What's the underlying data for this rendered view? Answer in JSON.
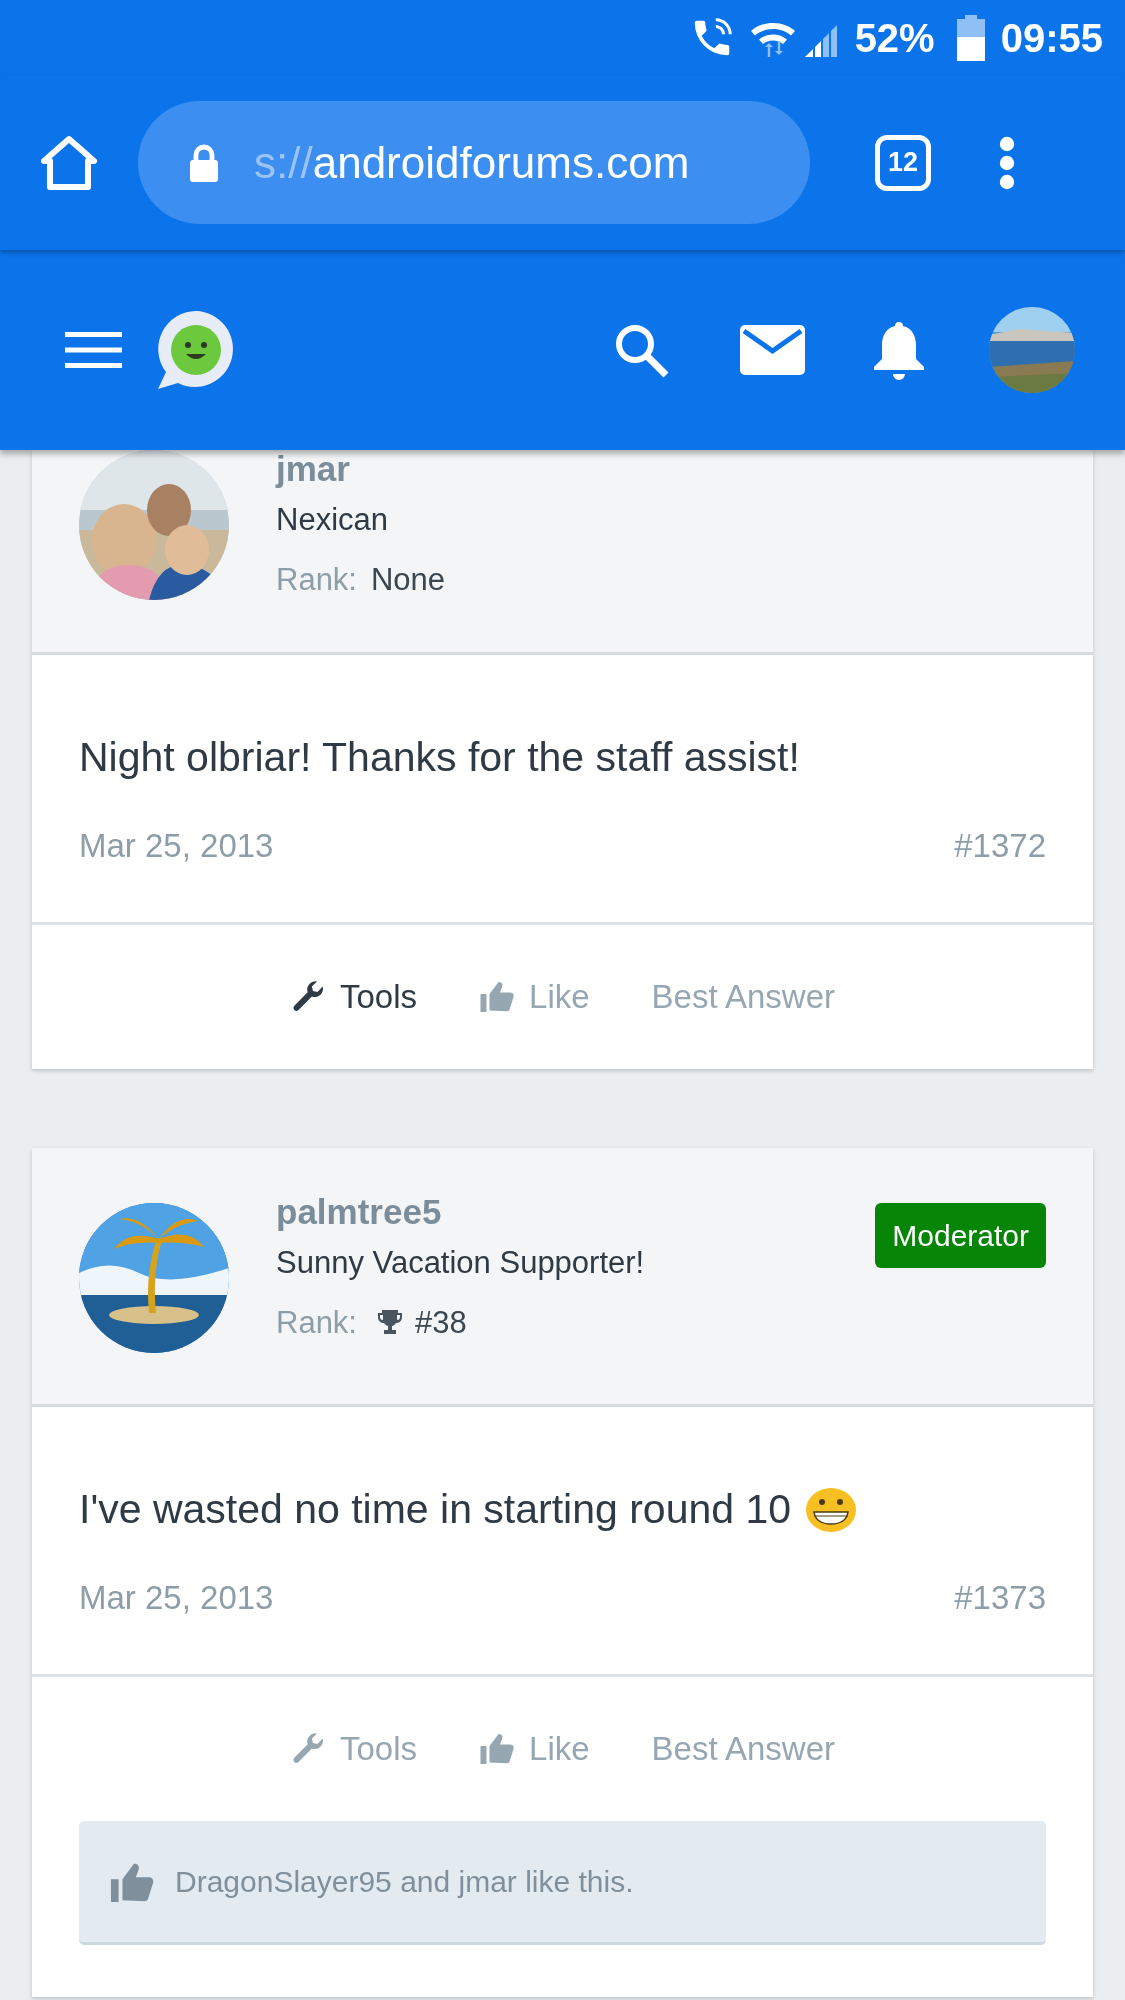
{
  "status_bar": {
    "battery_text": "52%",
    "time": "09:55"
  },
  "browser": {
    "url_faded": "s://",
    "url": "androidforums.com",
    "tab_count": "12"
  },
  "posts": [
    {
      "author": "jmar",
      "title": "Nexican",
      "rank_label": "Rank:",
      "rank": {
        "kind": "plain",
        "text": "None"
      },
      "body": "Night olbriar! Thanks for the staff assist!",
      "date": "Mar 25, 2013",
      "number": "#1372",
      "actions": [
        {
          "kind": "tools",
          "label": "Tools",
          "active": true
        },
        {
          "kind": "like",
          "label": "Like",
          "active": false
        },
        {
          "kind": "plain",
          "label": "Best Answer",
          "active": false
        }
      ]
    },
    {
      "author": "palmtree5",
      "title": "Sunny Vacation Supporter!",
      "rank_label": "Rank:",
      "rank": {
        "kind": "trophy",
        "text": "#38"
      },
      "badge": "Moderator",
      "body": "I've wasted no time in starting round 10",
      "emoji": true,
      "date": "Mar 25, 2013",
      "number": "#1373",
      "actions": [
        {
          "kind": "tools",
          "label": "Tools",
          "active": false
        },
        {
          "kind": "like",
          "label": "Like",
          "active": false
        },
        {
          "kind": "plain",
          "label": "Best Answer",
          "active": false
        }
      ],
      "likes_text": "DragonSlayer95 and jmar like this."
    }
  ]
}
